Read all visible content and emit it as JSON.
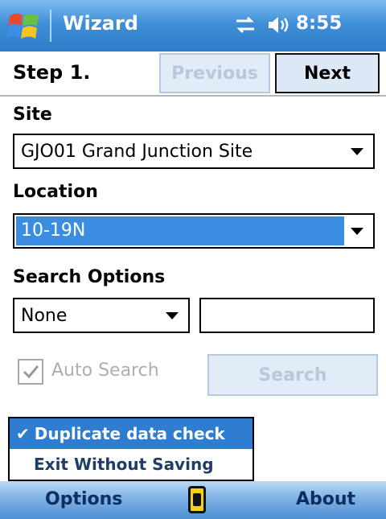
{
  "status_bar": {
    "app_title": "Wizard",
    "time": "8:55"
  },
  "step": {
    "label": "Step 1.",
    "previous_label": "Previous",
    "next_label": "Next"
  },
  "site": {
    "label": "Site",
    "value": "GJO01 Grand Junction Site"
  },
  "location": {
    "label": "Location",
    "value": "10-19N"
  },
  "search_options": {
    "label": "Search Options",
    "value": "None",
    "query": ""
  },
  "auto_search": {
    "label": "Auto Search",
    "checked": true
  },
  "search_button": {
    "label": "Search"
  },
  "menu": {
    "items": [
      {
        "label": "Duplicate data check",
        "checked": true
      },
      {
        "label": "Exit Without Saving",
        "checked": false
      }
    ]
  },
  "softkeys": {
    "left": "Options",
    "right": "About"
  },
  "colors": {
    "accent": "#2f7dd1",
    "disabled_text": "#b8c8da"
  }
}
